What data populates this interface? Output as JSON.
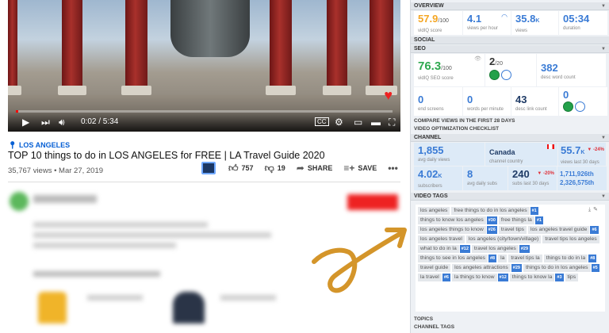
{
  "video": {
    "time": "0:02 / 5:34",
    "progress_fraction": 0.006
  },
  "info": {
    "location": "LOS ANGELES",
    "title": "TOP 10 things to do in LOS ANGELES for FREE | LA Travel Guide 2020",
    "views_date": "35,767 views • Mar 27, 2019",
    "likes": "757",
    "dislikes": "19",
    "share": "SHARE",
    "save": "SAVE"
  },
  "panel": {
    "overview": {
      "header": "OVERVIEW",
      "score": "57.9",
      "score_unit": "/100",
      "score_label": "vidIQ score",
      "vph": "4.1",
      "vph_label": "views per hour",
      "views": "35.8",
      "views_unit": "K",
      "views_label": "views",
      "duration": "05:34",
      "duration_label": "duration"
    },
    "social_header": "SOCIAL",
    "seo": {
      "header": "SEO",
      "score": "76.3",
      "score_unit": "/100",
      "score_label": "vidIQ SEO score",
      "x_of": "2",
      "x_of_unit": "/20",
      "desc_words": "382",
      "desc_words_label": "desc word count",
      "end_screens": "0",
      "end_screens_label": "end screens",
      "wpm": "0",
      "wpm_label": "words per minute",
      "desc_links": "43",
      "desc_links_label": "desc link count",
      "last": "0"
    },
    "compare_label": "COMPARE VIEWS IN THE FIRST 28 DAYS",
    "checklist_label": "VIDEO OPTIMIZATION CHECKLIST",
    "channel": {
      "header": "CHANNEL",
      "avg_daily_views": "1,855",
      "avg_daily_views_label": "avg daily views",
      "country": "Canada",
      "country_label": "channel country",
      "views_30": "55.7",
      "views_30_unit": "K",
      "views_30_change": "▼ -24%",
      "views_30_label": "views last 30 days",
      "subscribers": "4.02",
      "subscribers_unit": "K",
      "subscribers_label": "subscribers",
      "avg_daily_subs": "8",
      "avg_daily_subs_label": "avg daily subs",
      "subs_30": "240",
      "subs_30_change": "▼ -20%",
      "subs_30_label": "subs last 30 days",
      "rank_1": "1,711,926th",
      "rank_2": "2,326,575th"
    },
    "tags_header": "VIDEO TAGS",
    "tags": [
      {
        "text": "los angeles",
        "rank": ""
      },
      {
        "text": "free things to do in los angeles",
        "rank": "#1"
      },
      {
        "text": "things to know los angeles",
        "rank": "#30"
      },
      {
        "text": "free things la",
        "rank": "#1"
      },
      {
        "text": "los angeles things to know",
        "rank": "#26"
      },
      {
        "text": "travel tips",
        "rank": ""
      },
      {
        "text": "los angeles travel guide",
        "rank": "#6"
      },
      {
        "text": "los angeles travel",
        "rank": ""
      },
      {
        "text": "los angeles (city/town/village)",
        "rank": ""
      },
      {
        "text": "travel tips los angeles",
        "rank": ""
      },
      {
        "text": "what to do in la",
        "rank": "#12"
      },
      {
        "text": "travel los angeles",
        "rank": "#29"
      },
      {
        "text": "things to see in los angeles",
        "rank": "#8"
      },
      {
        "text": "la",
        "rank": ""
      },
      {
        "text": "travel tips la",
        "rank": ""
      },
      {
        "text": "things to do in la",
        "rank": "#8"
      },
      {
        "text": "travel guide",
        "rank": ""
      },
      {
        "text": "los angeles attractions",
        "rank": "#29"
      },
      {
        "text": "things to do in los angeles",
        "rank": "#5"
      },
      {
        "text": "la travel",
        "rank": "#6"
      },
      {
        "text": "la things to know",
        "rank": "#12"
      },
      {
        "text": "things to know la",
        "rank": "#3"
      },
      {
        "text": "tips",
        "rank": ""
      }
    ],
    "topics_label": "TOPICS",
    "channel_tags_label": "CHANNEL TAGS",
    "colors": {
      "accent_blue": "#3a7bd5",
      "score_orange": "#f5a623",
      "seo_green": "#2fa84f",
      "decline_red": "#e0323a"
    }
  }
}
